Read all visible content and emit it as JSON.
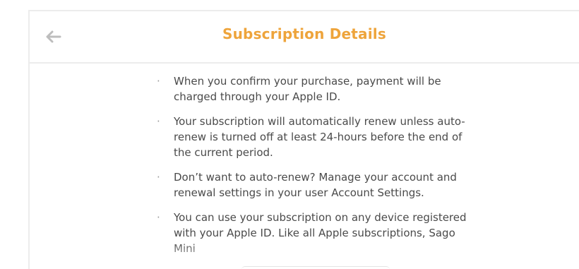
{
  "header": {
    "back_icon": "arrow-left-icon",
    "title": "Subscription Details",
    "title_color": "#eea43b"
  },
  "details": {
    "bullet": "·",
    "items": [
      {
        "text": "When you confirm your purchase, payment will be charged through your Apple ID."
      },
      {
        "text": "Your subscription will automatically renew unless auto-renew is turned off at least 24-hours before the end of the current period."
      },
      {
        "text": "Don’t want to auto-renew? Manage your account and renewal settings in your user Account Settings."
      },
      {
        "text": "You can use your subscription on any device registered with your Apple ID. Like all Apple subscriptions, Sago Mini"
      }
    ]
  },
  "colors": {
    "text": "#4a4a4a",
    "bullet": "#9a9a9a",
    "border": "#ececec",
    "icon": "#bdbdbd"
  }
}
